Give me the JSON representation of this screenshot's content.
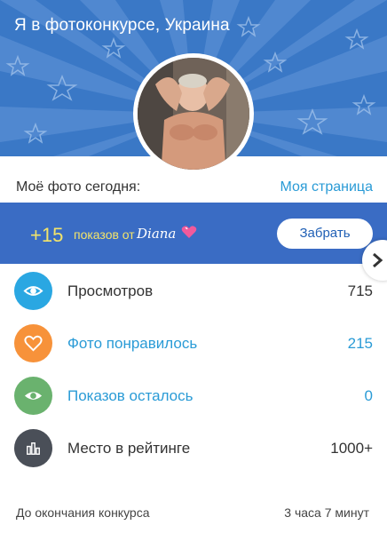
{
  "header": {
    "title": "Я в фотоконкурсе, Украина"
  },
  "my_photo": {
    "label": "Моё фото сегодня:",
    "link": "Моя страница"
  },
  "bonus": {
    "amount": "+15",
    "text": "показов от",
    "from": "Diana",
    "button": "Забрать"
  },
  "stats": [
    {
      "label": "Просмотров",
      "value": "715",
      "icon": "eye-icon",
      "color": "#2aa7e2",
      "text_color": "#333333"
    },
    {
      "label": "Фото понравилось",
      "value": "215",
      "icon": "heart-icon",
      "color": "#f7923a",
      "text_color": "#2a9bd6"
    },
    {
      "label": "Показов осталось",
      "value": "0",
      "icon": "eye-icon",
      "color": "#6ab26e",
      "text_color": "#2a9bd6"
    },
    {
      "label": "Место в рейтинге",
      "value": "1000+",
      "icon": "bar-chart-icon",
      "color": "#4a4f58",
      "text_color": "#333333"
    }
  ],
  "footer": {
    "label": "До окончания конкурса",
    "value": "3 часа 7 минут"
  }
}
